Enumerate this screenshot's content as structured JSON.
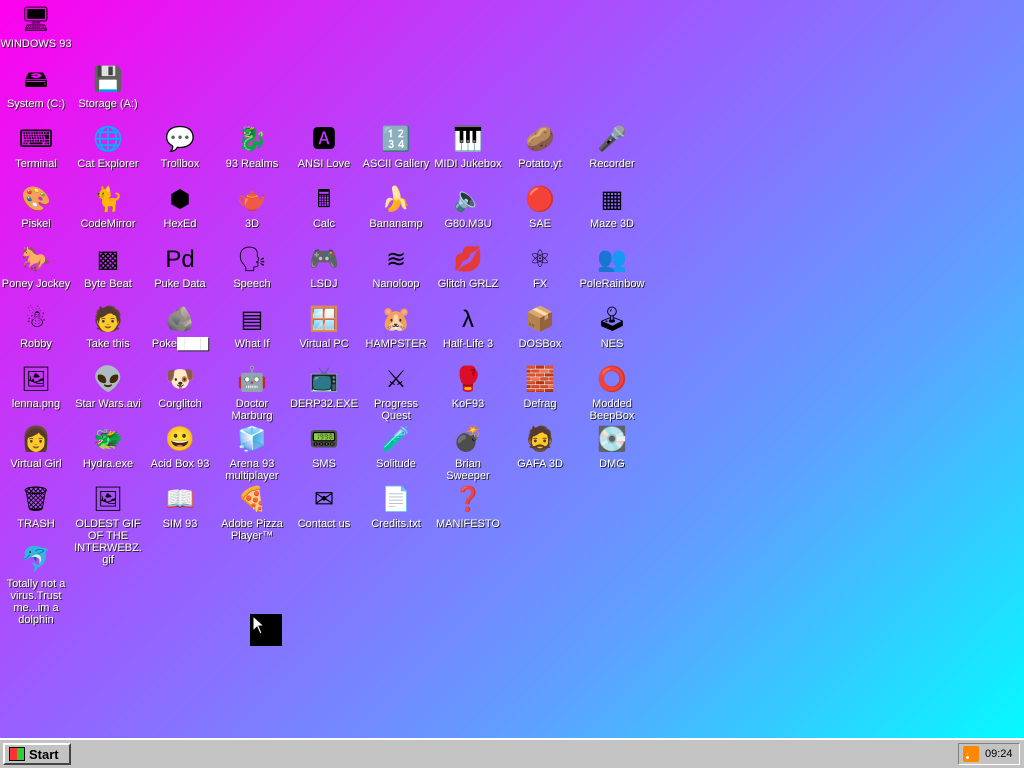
{
  "desktop": {
    "icons": [
      {
        "id": "windows93",
        "label": "WINDOWS 93",
        "glyph": "🖥",
        "col": 0,
        "row": 0
      },
      {
        "id": "system-c",
        "label": "System (C:)",
        "glyph": "🖴",
        "col": 0,
        "row": 1
      },
      {
        "id": "storage-a",
        "label": "Storage (A:)",
        "glyph": "💾",
        "col": 1,
        "row": 1
      },
      {
        "id": "terminal",
        "label": "Terminal",
        "glyph": "⌨",
        "col": 0,
        "row": 2
      },
      {
        "id": "cat-explorer",
        "label": "Cat Explorer",
        "glyph": "🌐",
        "col": 1,
        "row": 2
      },
      {
        "id": "trollbox",
        "label": "Trollbox",
        "glyph": "💬",
        "col": 2,
        "row": 2
      },
      {
        "id": "93-realms",
        "label": "93 Realms",
        "glyph": "🐉",
        "col": 3,
        "row": 2
      },
      {
        "id": "ansi-love",
        "label": "ANSI Love",
        "glyph": "🅰",
        "col": 4,
        "row": 2
      },
      {
        "id": "ascii-gallery",
        "label": "ASCII Gallery",
        "glyph": "🔢",
        "col": 5,
        "row": 2
      },
      {
        "id": "midi-jukebox",
        "label": "MIDI Jukebox",
        "glyph": "🎹",
        "col": 6,
        "row": 2
      },
      {
        "id": "potato-yt",
        "label": "Potato.yt",
        "glyph": "🥔",
        "col": 7,
        "row": 2
      },
      {
        "id": "recorder",
        "label": "Recorder",
        "glyph": "🎤",
        "col": 8,
        "row": 2
      },
      {
        "id": "piskel",
        "label": "Piskel",
        "glyph": "🎨",
        "col": 0,
        "row": 3
      },
      {
        "id": "codemirror",
        "label": "CodeMirror",
        "glyph": "🐈",
        "col": 1,
        "row": 3
      },
      {
        "id": "hexed",
        "label": "HexEd",
        "glyph": "⬢",
        "col": 2,
        "row": 3
      },
      {
        "id": "3d",
        "label": "3D",
        "glyph": "🫖",
        "col": 3,
        "row": 3
      },
      {
        "id": "calc",
        "label": "Calc",
        "glyph": "🖩",
        "col": 4,
        "row": 3
      },
      {
        "id": "bananamp",
        "label": "Bananamp",
        "glyph": "🍌",
        "col": 5,
        "row": 3
      },
      {
        "id": "g80m3u",
        "label": "G80.M3U",
        "glyph": "🔈",
        "col": 6,
        "row": 3
      },
      {
        "id": "sae",
        "label": "SAE",
        "glyph": "🔴",
        "col": 7,
        "row": 3
      },
      {
        "id": "maze3d",
        "label": "Maze 3D",
        "glyph": "▦",
        "col": 8,
        "row": 3
      },
      {
        "id": "poney-jockey",
        "label": "Poney Jockey",
        "glyph": "🐎",
        "col": 0,
        "row": 4
      },
      {
        "id": "byte-beat",
        "label": "Byte Beat",
        "glyph": "▩",
        "col": 1,
        "row": 4
      },
      {
        "id": "puke-data",
        "label": "Puke Data",
        "glyph": "Pd",
        "col": 2,
        "row": 4
      },
      {
        "id": "speech",
        "label": "Speech",
        "glyph": "🗣",
        "col": 3,
        "row": 4
      },
      {
        "id": "lsdj",
        "label": "LSDJ",
        "glyph": "🎮",
        "col": 4,
        "row": 4
      },
      {
        "id": "nanoloop",
        "label": "Nanoloop",
        "glyph": "≋",
        "col": 5,
        "row": 4
      },
      {
        "id": "glitch-grlz",
        "label": "Glitch GRLZ",
        "glyph": "💋",
        "col": 6,
        "row": 4
      },
      {
        "id": "fx",
        "label": "FX",
        "glyph": "⚛",
        "col": 7,
        "row": 4
      },
      {
        "id": "polerainbow",
        "label": "PoleRainbow",
        "glyph": "👥",
        "col": 8,
        "row": 4
      },
      {
        "id": "robby",
        "label": "Robby",
        "glyph": "☃",
        "col": 0,
        "row": 5
      },
      {
        "id": "take-this",
        "label": "Take this",
        "glyph": "🧑",
        "col": 1,
        "row": 5
      },
      {
        "id": "pokeball",
        "label": "Poke████",
        "glyph": "🪨",
        "col": 2,
        "row": 5
      },
      {
        "id": "what-if",
        "label": "What If",
        "glyph": "▤",
        "col": 3,
        "row": 5
      },
      {
        "id": "virtual-pc",
        "label": "Virtual PC",
        "glyph": "🪟",
        "col": 4,
        "row": 5
      },
      {
        "id": "hampster",
        "label": "HAMPSTER",
        "glyph": "🐹",
        "col": 5,
        "row": 5
      },
      {
        "id": "half-life-3",
        "label": "Half-Life 3",
        "glyph": "λ",
        "col": 6,
        "row": 5
      },
      {
        "id": "dosbox",
        "label": "DOSBox",
        "glyph": "📦",
        "col": 7,
        "row": 5
      },
      {
        "id": "nes",
        "label": "NES",
        "glyph": "🕹",
        "col": 8,
        "row": 5
      },
      {
        "id": "lenna",
        "label": "lenna.png",
        "glyph": "🖼",
        "col": 0,
        "row": 6
      },
      {
        "id": "star-wars",
        "label": "Star Wars.avi",
        "glyph": "👽",
        "col": 1,
        "row": 6
      },
      {
        "id": "corglitch",
        "label": "Corglitch",
        "glyph": "🐶",
        "col": 2,
        "row": 6
      },
      {
        "id": "doctor-marburg",
        "label": "Doctor Marburg",
        "glyph": "🤖",
        "col": 3,
        "row": 6
      },
      {
        "id": "derp32",
        "label": "DERP32.EXE",
        "glyph": "📺",
        "col": 4,
        "row": 6
      },
      {
        "id": "progress-quest",
        "label": "Progress Quest",
        "glyph": "⚔",
        "col": 5,
        "row": 6
      },
      {
        "id": "kof93",
        "label": "KoF93",
        "glyph": "🥊",
        "col": 6,
        "row": 6
      },
      {
        "id": "defrag",
        "label": "Defrag",
        "glyph": "🧱",
        "col": 7,
        "row": 6
      },
      {
        "id": "modded-beepbox",
        "label": "Modded BeepBox",
        "glyph": "⭕",
        "col": 8,
        "row": 6
      },
      {
        "id": "virtual-girl",
        "label": "Virtual Girl",
        "glyph": "👩",
        "col": 0,
        "row": 7
      },
      {
        "id": "hydra",
        "label": "Hydra.exe",
        "glyph": "🐲",
        "col": 1,
        "row": 7
      },
      {
        "id": "acid-box",
        "label": "Acid Box 93",
        "glyph": "😀",
        "col": 2,
        "row": 7
      },
      {
        "id": "arena93",
        "label": "Arena 93 multiplayer",
        "glyph": "🧊",
        "col": 3,
        "row": 7
      },
      {
        "id": "sms",
        "label": "SMS",
        "glyph": "📟",
        "col": 4,
        "row": 7
      },
      {
        "id": "solitude",
        "label": "Solitude",
        "glyph": "🧪",
        "col": 5,
        "row": 7
      },
      {
        "id": "brian-sweeper",
        "label": "Brian Sweeper",
        "glyph": "💣",
        "col": 6,
        "row": 7
      },
      {
        "id": "gafa3d",
        "label": "GAFA 3D",
        "glyph": "🧔",
        "col": 7,
        "row": 7
      },
      {
        "id": "dmg",
        "label": "DMG",
        "glyph": "💽",
        "col": 8,
        "row": 7
      },
      {
        "id": "trash",
        "label": "TRASH",
        "glyph": "🗑",
        "col": 0,
        "row": 8
      },
      {
        "id": "oldest-gif",
        "label": "OLDEST GIF OF THE INTERWEBZ.gif",
        "glyph": "🖼",
        "col": 1,
        "row": 8
      },
      {
        "id": "sim93",
        "label": "SIM 93",
        "glyph": "📖",
        "col": 2,
        "row": 8
      },
      {
        "id": "adobe-pizza",
        "label": "Adobe Pizza Player™",
        "glyph": "🍕",
        "col": 3,
        "row": 8
      },
      {
        "id": "contact-us",
        "label": "Contact us",
        "glyph": "✉",
        "col": 4,
        "row": 8
      },
      {
        "id": "credits",
        "label": "Credits.txt",
        "glyph": "📄",
        "col": 5,
        "row": 8
      },
      {
        "id": "manifesto",
        "label": "MANIFESTO",
        "glyph": "❓",
        "col": 6,
        "row": 8
      },
      {
        "id": "dolphin",
        "label": "Totally not a virus.Trust me...im a dolphin",
        "glyph": "🐬",
        "col": 0,
        "row": 9
      }
    ]
  },
  "taskbar": {
    "start_label": "Start",
    "clock": "09:24"
  }
}
